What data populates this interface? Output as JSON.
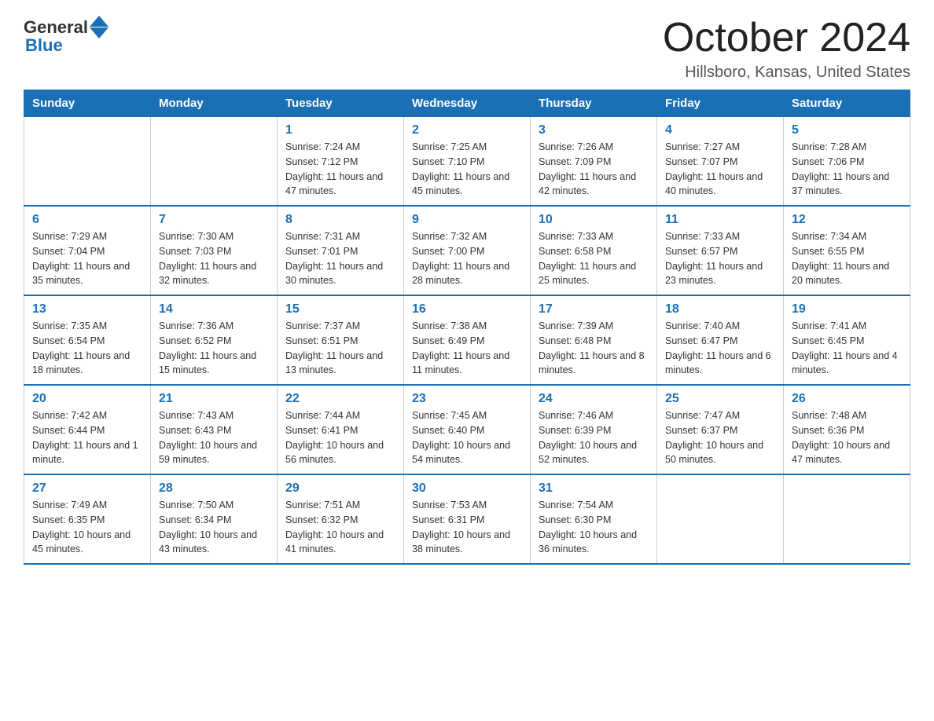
{
  "header": {
    "logo_general": "General",
    "logo_blue": "Blue",
    "title": "October 2024",
    "location": "Hillsboro, Kansas, United States"
  },
  "days_of_week": [
    "Sunday",
    "Monday",
    "Tuesday",
    "Wednesday",
    "Thursday",
    "Friday",
    "Saturday"
  ],
  "weeks": [
    [
      {
        "day": "",
        "sunrise": "",
        "sunset": "",
        "daylight": ""
      },
      {
        "day": "",
        "sunrise": "",
        "sunset": "",
        "daylight": ""
      },
      {
        "day": "1",
        "sunrise": "Sunrise: 7:24 AM",
        "sunset": "Sunset: 7:12 PM",
        "daylight": "Daylight: 11 hours and 47 minutes."
      },
      {
        "day": "2",
        "sunrise": "Sunrise: 7:25 AM",
        "sunset": "Sunset: 7:10 PM",
        "daylight": "Daylight: 11 hours and 45 minutes."
      },
      {
        "day": "3",
        "sunrise": "Sunrise: 7:26 AM",
        "sunset": "Sunset: 7:09 PM",
        "daylight": "Daylight: 11 hours and 42 minutes."
      },
      {
        "day": "4",
        "sunrise": "Sunrise: 7:27 AM",
        "sunset": "Sunset: 7:07 PM",
        "daylight": "Daylight: 11 hours and 40 minutes."
      },
      {
        "day": "5",
        "sunrise": "Sunrise: 7:28 AM",
        "sunset": "Sunset: 7:06 PM",
        "daylight": "Daylight: 11 hours and 37 minutes."
      }
    ],
    [
      {
        "day": "6",
        "sunrise": "Sunrise: 7:29 AM",
        "sunset": "Sunset: 7:04 PM",
        "daylight": "Daylight: 11 hours and 35 minutes."
      },
      {
        "day": "7",
        "sunrise": "Sunrise: 7:30 AM",
        "sunset": "Sunset: 7:03 PM",
        "daylight": "Daylight: 11 hours and 32 minutes."
      },
      {
        "day": "8",
        "sunrise": "Sunrise: 7:31 AM",
        "sunset": "Sunset: 7:01 PM",
        "daylight": "Daylight: 11 hours and 30 minutes."
      },
      {
        "day": "9",
        "sunrise": "Sunrise: 7:32 AM",
        "sunset": "Sunset: 7:00 PM",
        "daylight": "Daylight: 11 hours and 28 minutes."
      },
      {
        "day": "10",
        "sunrise": "Sunrise: 7:33 AM",
        "sunset": "Sunset: 6:58 PM",
        "daylight": "Daylight: 11 hours and 25 minutes."
      },
      {
        "day": "11",
        "sunrise": "Sunrise: 7:33 AM",
        "sunset": "Sunset: 6:57 PM",
        "daylight": "Daylight: 11 hours and 23 minutes."
      },
      {
        "day": "12",
        "sunrise": "Sunrise: 7:34 AM",
        "sunset": "Sunset: 6:55 PM",
        "daylight": "Daylight: 11 hours and 20 minutes."
      }
    ],
    [
      {
        "day": "13",
        "sunrise": "Sunrise: 7:35 AM",
        "sunset": "Sunset: 6:54 PM",
        "daylight": "Daylight: 11 hours and 18 minutes."
      },
      {
        "day": "14",
        "sunrise": "Sunrise: 7:36 AM",
        "sunset": "Sunset: 6:52 PM",
        "daylight": "Daylight: 11 hours and 15 minutes."
      },
      {
        "day": "15",
        "sunrise": "Sunrise: 7:37 AM",
        "sunset": "Sunset: 6:51 PM",
        "daylight": "Daylight: 11 hours and 13 minutes."
      },
      {
        "day": "16",
        "sunrise": "Sunrise: 7:38 AM",
        "sunset": "Sunset: 6:49 PM",
        "daylight": "Daylight: 11 hours and 11 minutes."
      },
      {
        "day": "17",
        "sunrise": "Sunrise: 7:39 AM",
        "sunset": "Sunset: 6:48 PM",
        "daylight": "Daylight: 11 hours and 8 minutes."
      },
      {
        "day": "18",
        "sunrise": "Sunrise: 7:40 AM",
        "sunset": "Sunset: 6:47 PM",
        "daylight": "Daylight: 11 hours and 6 minutes."
      },
      {
        "day": "19",
        "sunrise": "Sunrise: 7:41 AM",
        "sunset": "Sunset: 6:45 PM",
        "daylight": "Daylight: 11 hours and 4 minutes."
      }
    ],
    [
      {
        "day": "20",
        "sunrise": "Sunrise: 7:42 AM",
        "sunset": "Sunset: 6:44 PM",
        "daylight": "Daylight: 11 hours and 1 minute."
      },
      {
        "day": "21",
        "sunrise": "Sunrise: 7:43 AM",
        "sunset": "Sunset: 6:43 PM",
        "daylight": "Daylight: 10 hours and 59 minutes."
      },
      {
        "day": "22",
        "sunrise": "Sunrise: 7:44 AM",
        "sunset": "Sunset: 6:41 PM",
        "daylight": "Daylight: 10 hours and 56 minutes."
      },
      {
        "day": "23",
        "sunrise": "Sunrise: 7:45 AM",
        "sunset": "Sunset: 6:40 PM",
        "daylight": "Daylight: 10 hours and 54 minutes."
      },
      {
        "day": "24",
        "sunrise": "Sunrise: 7:46 AM",
        "sunset": "Sunset: 6:39 PM",
        "daylight": "Daylight: 10 hours and 52 minutes."
      },
      {
        "day": "25",
        "sunrise": "Sunrise: 7:47 AM",
        "sunset": "Sunset: 6:37 PM",
        "daylight": "Daylight: 10 hours and 50 minutes."
      },
      {
        "day": "26",
        "sunrise": "Sunrise: 7:48 AM",
        "sunset": "Sunset: 6:36 PM",
        "daylight": "Daylight: 10 hours and 47 minutes."
      }
    ],
    [
      {
        "day": "27",
        "sunrise": "Sunrise: 7:49 AM",
        "sunset": "Sunset: 6:35 PM",
        "daylight": "Daylight: 10 hours and 45 minutes."
      },
      {
        "day": "28",
        "sunrise": "Sunrise: 7:50 AM",
        "sunset": "Sunset: 6:34 PM",
        "daylight": "Daylight: 10 hours and 43 minutes."
      },
      {
        "day": "29",
        "sunrise": "Sunrise: 7:51 AM",
        "sunset": "Sunset: 6:32 PM",
        "daylight": "Daylight: 10 hours and 41 minutes."
      },
      {
        "day": "30",
        "sunrise": "Sunrise: 7:53 AM",
        "sunset": "Sunset: 6:31 PM",
        "daylight": "Daylight: 10 hours and 38 minutes."
      },
      {
        "day": "31",
        "sunrise": "Sunrise: 7:54 AM",
        "sunset": "Sunset: 6:30 PM",
        "daylight": "Daylight: 10 hours and 36 minutes."
      },
      {
        "day": "",
        "sunrise": "",
        "sunset": "",
        "daylight": ""
      },
      {
        "day": "",
        "sunrise": "",
        "sunset": "",
        "daylight": ""
      }
    ]
  ]
}
